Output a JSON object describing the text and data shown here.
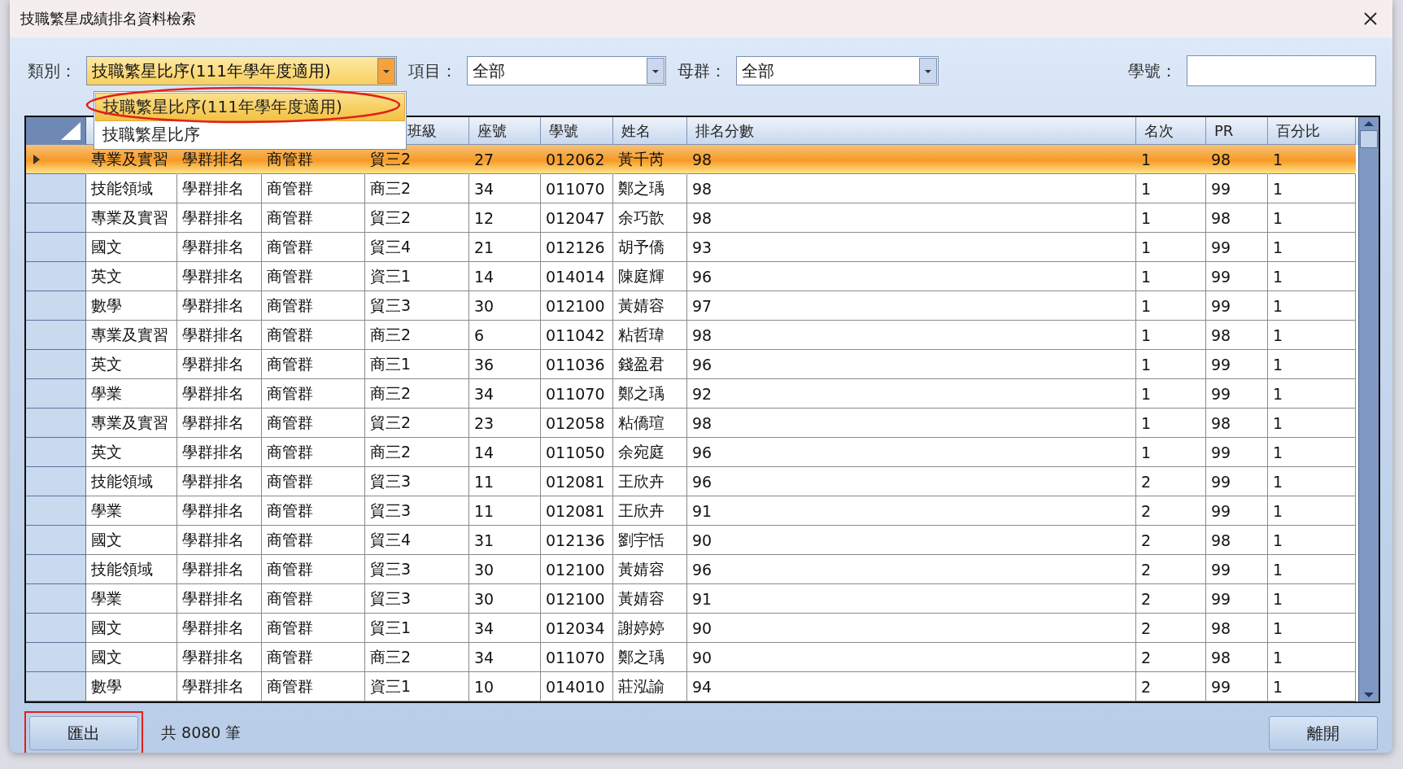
{
  "window": {
    "title": "技職繁星成績排名資料檢索"
  },
  "filters": [
    {
      "kind": "combo",
      "label": "類別：",
      "value": "技職繁星比序(111年學年度適用)",
      "active": true
    },
    {
      "kind": "combo",
      "label": "項目：",
      "value": "全部",
      "active": false
    },
    {
      "kind": "combo",
      "label": "母群：",
      "value": "全部",
      "active": false
    },
    {
      "kind": "text",
      "label": "學號："
    }
  ],
  "dropdown": {
    "options": [
      {
        "label": "技職繁星比序(111年學年度適用)",
        "selected": true,
        "circled": true
      },
      {
        "label": "技職繁星比序",
        "selected": false,
        "circled": false
      }
    ]
  },
  "table": {
    "columns": [
      {},
      {},
      {},
      {
        "label": "班級"
      },
      {
        "label": "座號"
      },
      {
        "label": "學號"
      },
      {
        "label": "姓名"
      },
      {
        "label": "排名分數"
      },
      {
        "label": "名次"
      },
      {
        "label": "PR"
      },
      {
        "label": "百分比"
      }
    ],
    "rows": [
      {
        "selected": true,
        "cells": [
          "專業及實習",
          "學群排名",
          "商管群",
          "貿三2",
          "27",
          "012062",
          "黃千芮",
          "98",
          "1",
          "98",
          "1"
        ]
      },
      {
        "selected": false,
        "cells": [
          "技能領域",
          "學群排名",
          "商管群",
          "商三2",
          "34",
          "011070",
          "鄭之瑀",
          "98",
          "1",
          "99",
          "1"
        ]
      },
      {
        "selected": false,
        "cells": [
          "專業及實習",
          "學群排名",
          "商管群",
          "貿三2",
          "12",
          "012047",
          "余巧歆",
          "98",
          "1",
          "98",
          "1"
        ]
      },
      {
        "selected": false,
        "cells": [
          "國文",
          "學群排名",
          "商管群",
          "貿三4",
          "21",
          "012126",
          "胡予僑",
          "93",
          "1",
          "99",
          "1"
        ]
      },
      {
        "selected": false,
        "cells": [
          "英文",
          "學群排名",
          "商管群",
          "資三1",
          "14",
          "014014",
          "陳庭輝",
          "96",
          "1",
          "99",
          "1"
        ]
      },
      {
        "selected": false,
        "cells": [
          "數學",
          "學群排名",
          "商管群",
          "貿三3",
          "30",
          "012100",
          "黃婧容",
          "97",
          "1",
          "99",
          "1"
        ]
      },
      {
        "selected": false,
        "cells": [
          "專業及實習",
          "學群排名",
          "商管群",
          "商三2",
          "6",
          "011042",
          "粘哲瑋",
          "98",
          "1",
          "98",
          "1"
        ]
      },
      {
        "selected": false,
        "cells": [
          "英文",
          "學群排名",
          "商管群",
          "商三1",
          "36",
          "011036",
          "錢盈君",
          "96",
          "1",
          "99",
          "1"
        ]
      },
      {
        "selected": false,
        "cells": [
          "學業",
          "學群排名",
          "商管群",
          "商三2",
          "34",
          "011070",
          "鄭之瑀",
          "92",
          "1",
          "99",
          "1"
        ]
      },
      {
        "selected": false,
        "cells": [
          "專業及實習",
          "學群排名",
          "商管群",
          "貿三2",
          "23",
          "012058",
          "粘僑瑄",
          "98",
          "1",
          "98",
          "1"
        ]
      },
      {
        "selected": false,
        "cells": [
          "英文",
          "學群排名",
          "商管群",
          "商三2",
          "14",
          "011050",
          "余宛庭",
          "96",
          "1",
          "99",
          "1"
        ]
      },
      {
        "selected": false,
        "cells": [
          "技能領域",
          "學群排名",
          "商管群",
          "貿三3",
          "11",
          "012081",
          "王欣卉",
          "96",
          "2",
          "99",
          "1"
        ]
      },
      {
        "selected": false,
        "cells": [
          "學業",
          "學群排名",
          "商管群",
          "貿三3",
          "11",
          "012081",
          "王欣卉",
          "91",
          "2",
          "99",
          "1"
        ]
      },
      {
        "selected": false,
        "cells": [
          "國文",
          "學群排名",
          "商管群",
          "貿三4",
          "31",
          "012136",
          "劉宇恬",
          "90",
          "2",
          "98",
          "1"
        ]
      },
      {
        "selected": false,
        "cells": [
          "技能領域",
          "學群排名",
          "商管群",
          "貿三3",
          "30",
          "012100",
          "黃婧容",
          "96",
          "2",
          "99",
          "1"
        ]
      },
      {
        "selected": false,
        "cells": [
          "學業",
          "學群排名",
          "商管群",
          "貿三3",
          "30",
          "012100",
          "黃婧容",
          "91",
          "2",
          "99",
          "1"
        ]
      },
      {
        "selected": false,
        "cells": [
          "國文",
          "學群排名",
          "商管群",
          "貿三1",
          "34",
          "012034",
          "謝婷婷",
          "90",
          "2",
          "98",
          "1"
        ]
      },
      {
        "selected": false,
        "cells": [
          "國文",
          "學群排名",
          "商管群",
          "商三2",
          "34",
          "011070",
          "鄭之瑀",
          "90",
          "2",
          "98",
          "1"
        ]
      },
      {
        "selected": false,
        "cells": [
          "數學",
          "學群排名",
          "商管群",
          "資三1",
          "10",
          "014010",
          "莊泓諭",
          "94",
          "2",
          "99",
          "1"
        ]
      }
    ]
  },
  "footer": {
    "export_button": {
      "label": "匯出",
      "outlined": true
    },
    "count": "共 8080 筆",
    "close_button": "離開"
  }
}
